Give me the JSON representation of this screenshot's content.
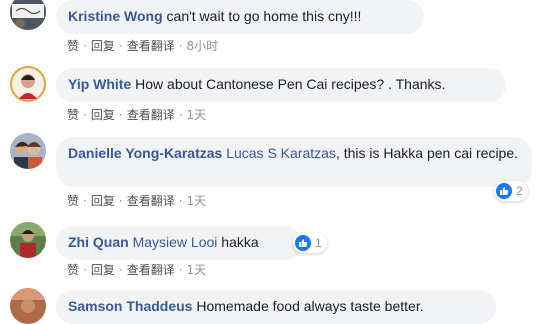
{
  "comments": [
    {
      "author": "Kristine Wong",
      "tag": "",
      "text": "can't wait to go home this cny!!!",
      "actions": {
        "like": "赞",
        "reply": "回复",
        "translate": "查看翻译",
        "time": "8小时"
      },
      "reactions": null
    },
    {
      "author": "Yip White",
      "tag": "",
      "text": "How about Cantonese Pen Cai recipes? . Thanks.",
      "actions": {
        "like": "赞",
        "reply": "回复",
        "translate": "查看翻译",
        "time": "1天"
      },
      "reactions": null
    },
    {
      "author": "Danielle Yong-Karatzas",
      "tag": "Lucas S Karatzas",
      "text": ", this is Hakka pen cai recipe.",
      "actions": {
        "like": "赞",
        "reply": "回复",
        "translate": "查看翻译",
        "time": "1天"
      },
      "reactions": "2"
    },
    {
      "author": "Zhi Quan",
      "tag": "Maysiew Looi",
      "text": "hakka",
      "actions": {
        "like": "赞",
        "reply": "回复",
        "translate": "查看翻译",
        "time": "1天"
      },
      "reactions": "1"
    },
    {
      "author": "Samson Thaddeus",
      "tag": "",
      "text": "Homemade food always taste better.",
      "actions": null,
      "reactions": null
    }
  ],
  "colors": {
    "author": "#385898",
    "bubble": "#f2f3f5",
    "like": "#1877f2"
  },
  "icons": {
    "reaction": "like-icon"
  }
}
